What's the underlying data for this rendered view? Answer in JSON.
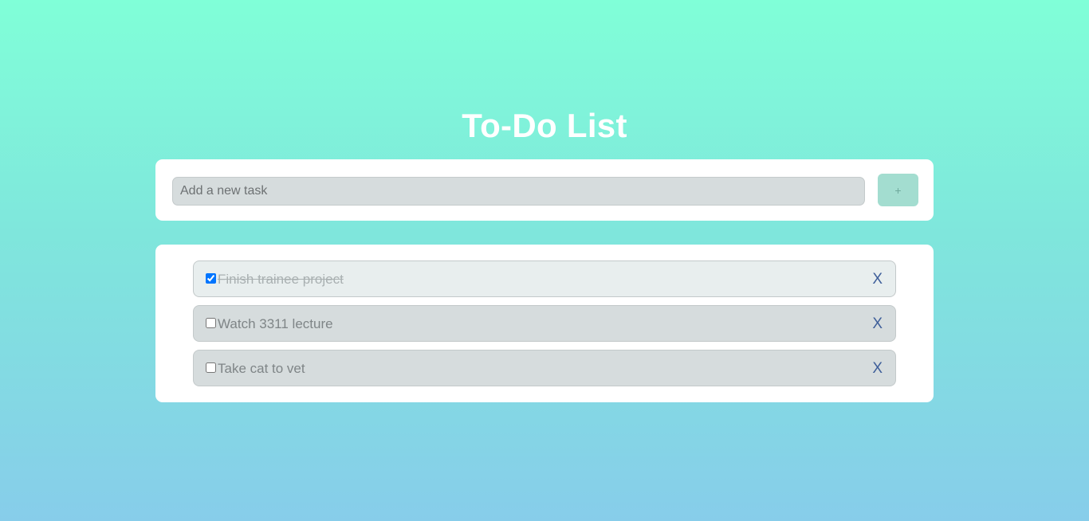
{
  "page": {
    "title": "To-Do List"
  },
  "new_task": {
    "placeholder": "Add a new task",
    "value": "",
    "add_label": "+"
  },
  "todos": [
    {
      "text": "Finish trainee project",
      "completed": true,
      "delete_label": "X"
    },
    {
      "text": "Watch 3311 lecture",
      "completed": false,
      "delete_label": "X"
    },
    {
      "text": "Take cat to vet",
      "completed": false,
      "delete_label": "X"
    }
  ],
  "colors": {
    "background_top": "#80ffd8",
    "background_bottom": "#87cdea",
    "card": "#ffffff",
    "add_button": "#a3ddd0",
    "delete_x": "#3f5f9a"
  }
}
